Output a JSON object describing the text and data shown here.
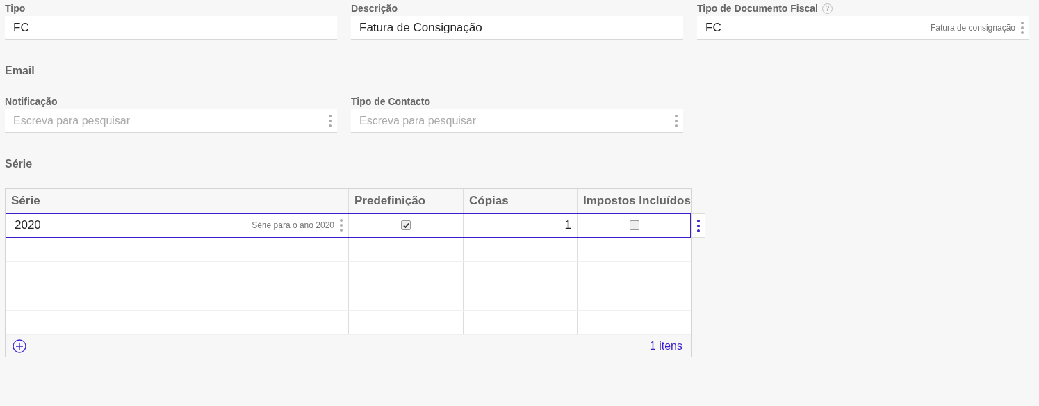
{
  "form_fields": [
    {
      "kind": "text",
      "label": "Tipo",
      "value": "FC"
    },
    {
      "kind": "text",
      "label": "Descrição",
      "value": "Fatura de Consignação"
    },
    {
      "kind": "lookup",
      "label": "Tipo de Documento Fiscal",
      "help": "?",
      "value": "FC",
      "hint": "Fatura de consignação"
    }
  ],
  "email_section": {
    "title": "Email",
    "fields": [
      {
        "kind": "lookup",
        "label": "Notificação",
        "placeholder": "Escreva para pesquisar"
      },
      {
        "kind": "lookup",
        "label": "Tipo de Contacto",
        "placeholder": "Escreva para pesquisar"
      }
    ]
  },
  "serie_section": {
    "title": "Série",
    "table": {
      "columns": [
        "Série",
        "Predefinição",
        "Cópias",
        "Impostos Incluídos"
      ],
      "rows": [
        {
          "serie": "2020",
          "serie_hint": "Série para o ano 2020",
          "predefinicao": true,
          "copias": "1",
          "impostos_incluidos": false,
          "selected": true
        }
      ],
      "footer_count": "1 itens"
    }
  }
}
